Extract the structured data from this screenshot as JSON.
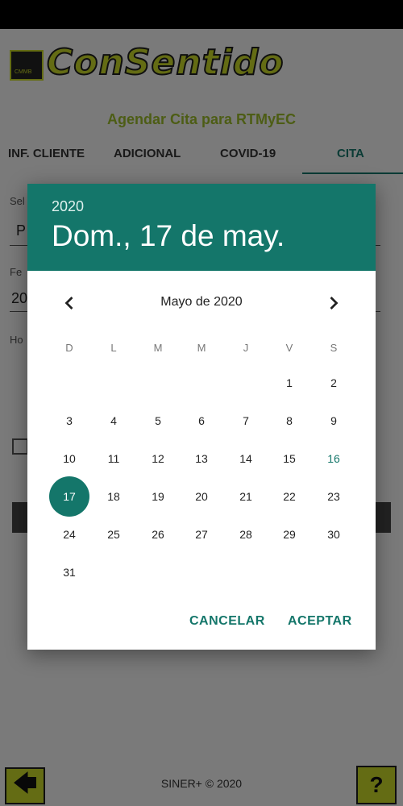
{
  "app": {
    "logo_text": "ConSentido",
    "logo_badge_text": "CMMB",
    "subtitle": "Agendar Cita para RTMyEC",
    "tabs": [
      {
        "label": "INF. CLIENTE"
      },
      {
        "label": "ADICIONAL"
      },
      {
        "label": "COVID-19"
      },
      {
        "label": "CITA",
        "active": true
      }
    ],
    "form": {
      "label1": "Sel",
      "value1": "P",
      "label2": "Fe",
      "value2": "20",
      "label3": "Ho"
    },
    "footer": {
      "back_icon": "arrow-left-icon",
      "text": "SINER+ © 2020",
      "help_icon": "help-icon"
    }
  },
  "date_picker": {
    "year": "2020",
    "selected_date_display": "Dom., 17 de may.",
    "month_title": "Mayo de 2020",
    "prev_icon": "chevron-left-icon",
    "next_icon": "chevron-right-icon",
    "weekdays": [
      "D",
      "L",
      "M",
      "M",
      "J",
      "V",
      "S"
    ],
    "first_weekday_index": 5,
    "days_in_month": 31,
    "today_day": 16,
    "selected_day": 17,
    "cancel_label": "CANCELAR",
    "accept_label": "ACEPTAR"
  },
  "colors": {
    "accent": "#14766a",
    "brand": "#c9d928"
  }
}
